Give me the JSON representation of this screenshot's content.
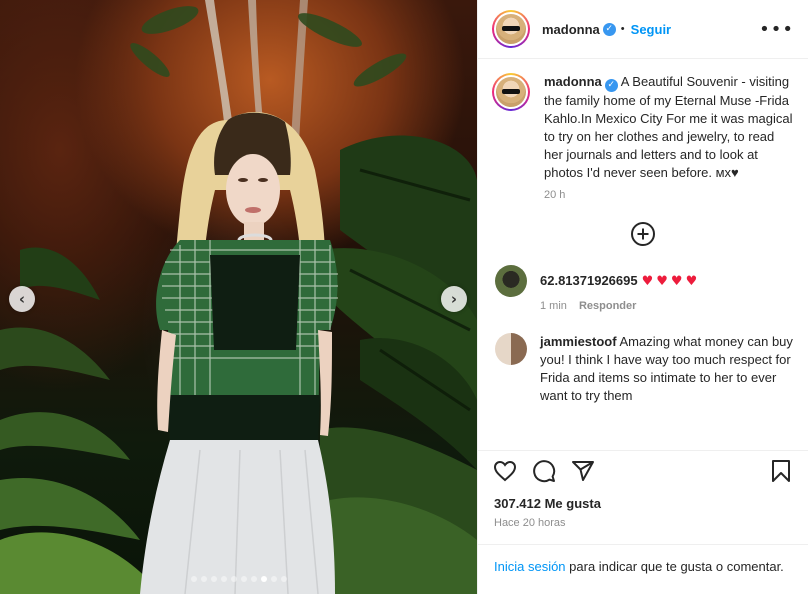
{
  "post": {
    "username": "madonna",
    "verified_mark": "✓",
    "separator": "•",
    "follow_label": "Seguir",
    "more_label": "•••"
  },
  "caption": {
    "username": "madonna",
    "text": "A Beautiful Souvenir - visiting the family home of my Eternal Muse -Frida Kahlo.In Mexico City For me it was magical to try on her clothes and jewelry, to read her journals and letters and to look at photos I'd never seen before. ᴍx♥",
    "time": "20 h"
  },
  "comments": [
    {
      "username": "62.81371926695",
      "text": "",
      "hearts": "♥♥♥♥",
      "time": "1 min",
      "reply_label": "Responder",
      "avatar_color": "#3f4a2c"
    },
    {
      "username": "jammiestoof",
      "text": "Amazing what money can buy you! I think I have way too much respect for Frida and items so intimate to her to ever want to try them",
      "avatar_color": "#6b4a36"
    }
  ],
  "stats": {
    "likes": "307.412 Me gusta",
    "posted": "Hace 20 horas"
  },
  "footer": {
    "login_link": "Inicia sesión",
    "login_rest": " para indicar que te gusta o comentar."
  },
  "carousel": {
    "prev_icon": "‹",
    "next_icon": "›",
    "dot_count": 10,
    "active_dot": 7
  },
  "colors": {
    "accent": "#0095f6",
    "heart": "#ed1c3c",
    "verified": "#3897f0"
  }
}
